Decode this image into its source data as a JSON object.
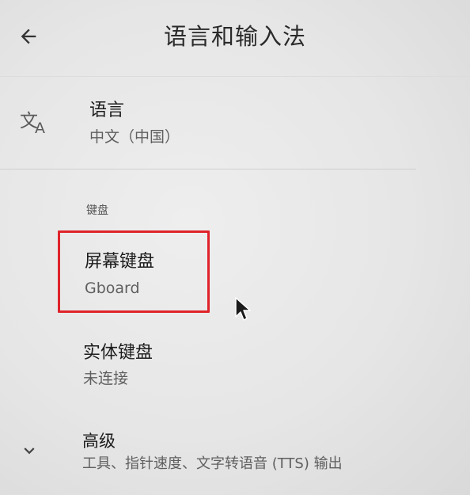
{
  "header": {
    "back_icon": "arrow-back-icon",
    "title": "语言和输入法"
  },
  "language": {
    "icon": "translate-icon",
    "title": "语言",
    "value": "中文（中国）"
  },
  "keyboard_section": {
    "label": "键盘",
    "screen_keyboard": {
      "title": "屏幕键盘",
      "value": "Gboard"
    },
    "physical_keyboard": {
      "title": "实体键盘",
      "value": "未连接"
    }
  },
  "advanced": {
    "icon": "chevron-down-icon",
    "title": "高级",
    "summary": "工具、指针速度、文字转语音 (TTS) 输出"
  },
  "colors": {
    "highlight": "#e0232a",
    "background": "#e6e6e6"
  }
}
